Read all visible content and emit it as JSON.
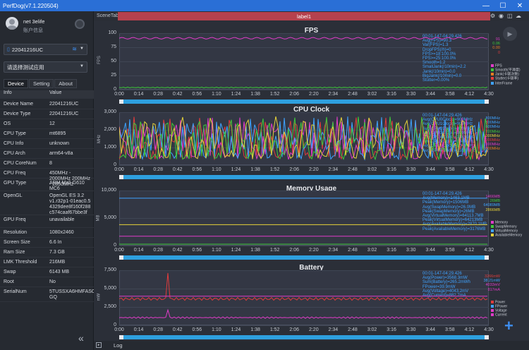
{
  "window": {
    "title": "PerfDog(v7.1.220504)"
  },
  "user": {
    "name": "net 3elife",
    "group": "账户信息"
  },
  "device_select": "22041216UC",
  "app_select": "请选择测试应用",
  "tabs": [
    "Device",
    "Setting",
    "About"
  ],
  "info": {
    "header": {
      "k": "Info",
      "v": "Value"
    },
    "rows": [
      {
        "k": "Device Name",
        "v": "22041216UC"
      },
      {
        "k": "Device Type",
        "v": "22041216UC"
      },
      {
        "k": "OS",
        "v": "12"
      },
      {
        "k": "CPU Type",
        "v": "mt6895"
      },
      {
        "k": "CPU Info",
        "v": "unknown"
      },
      {
        "k": "CPU Arch",
        "v": "arm64-v8a"
      },
      {
        "k": "CPU CoreNum",
        "v": "8"
      },
      {
        "k": "CPU Freq",
        "v": "450MHz - 2000MHz 200MHz - 2850MHz"
      },
      {
        "k": "GPU Type",
        "v": "ARM Mali-G610 MC6"
      },
      {
        "k": "OpenGL",
        "v": "OpenGL ES 3.2 v1.r32p1-01eac0.5 4329dee8f160f288 c574caaf67bbe3f"
      },
      {
        "k": "GPU Freq",
        "v": "unavailable"
      },
      {
        "k": "Resolution",
        "v": "1080x2460"
      },
      {
        "k": "Screen Size",
        "v": "6.6 In"
      },
      {
        "k": "Ram Size",
        "v": "7.3 GB"
      },
      {
        "k": "LMK Threshold",
        "v": "216MB"
      },
      {
        "k": "Swap",
        "v": "6143 MB"
      },
      {
        "k": "Root",
        "v": "No"
      },
      {
        "k": "SerialNum",
        "v": "5TUSSXA6HMFASO GQ"
      }
    ]
  },
  "scene": {
    "tab_label": "SceneTab",
    "label": "label1"
  },
  "xticks": [
    "0:00",
    "0:14",
    "0:28",
    "0:42",
    "0:56",
    "1:10",
    "1:24",
    "1:38",
    "1:52",
    "2:06",
    "2:20",
    "2:34",
    "2:48",
    "3:02",
    "3:16",
    "3:30",
    "3:44",
    "3:58",
    "4:12",
    "4:30"
  ],
  "panels": {
    "fps": {
      "title": "FPS",
      "ylabel": "FPS",
      "yticks": [
        "100",
        "75",
        "50",
        "25",
        "0"
      ],
      "stats": [
        "00:01-147-04:29.426",
        "Avg(FPS)=90.3",
        "Var(FPS)=1.3",
        "DropFPS(/h)=0",
        "FPS>=18:100.0%",
        "FPS>=25:100.0%",
        "Smooth=1.2",
        "SmallJank(/10min)=2.2",
        "Jank(/10min)=0.0",
        "BigJank(/10min)=0.0",
        "Stutter=0.00%"
      ],
      "vals": [
        {
          "t": "91",
          "c": "#e03cc8"
        },
        {
          "t": "0.06",
          "c": "#3ec93a"
        },
        {
          "t": "0.00",
          "c": "#e67e22"
        },
        {
          "t": "0",
          "c": "#e03c3c"
        }
      ],
      "legend": [
        {
          "t": "FPS",
          "c": "#e03cc8"
        },
        {
          "t": "Smooth(平滑度)",
          "c": "#3ec93a"
        },
        {
          "t": "Jank(卡顿次数)",
          "c": "#e67e22"
        },
        {
          "t": "Stutter(卡顿率)",
          "c": "#e03c3c"
        },
        {
          "t": "InterFrame",
          "c": "#3fa3ff"
        }
      ]
    },
    "cpu": {
      "title": "CPU Clock",
      "ylabel": "MHz",
      "yticks": [
        "3,000",
        "2,000",
        "1,000",
        "0"
      ],
      "stats": [
        "00:01-147-04:29.426",
        "Avg(CPU0Clock)=909MHz",
        "Avg(CPU1Clock)=909MHz",
        "Avg(CPU2Clock)=909MHz",
        "Avg(CPU3Clock)=909MHz",
        "Avg(CPU4Clock)=1349MHz",
        "Avg(CPU5Clock)=1349MHz",
        "Avg(CPU6Clock)=1349MHz",
        "Avg(CPU7Clock)=1553MHz"
      ],
      "vals": [
        {
          "t": "800MHz",
          "c": "#3fa3ff"
        },
        {
          "t": "800MHz",
          "c": "#3fa3ff"
        },
        {
          "t": "800MHz",
          "c": "#3fa3ff"
        },
        {
          "t": "800MHz",
          "c": "#3ec93a"
        },
        {
          "t": "1000MHz",
          "c": "#e6d23a"
        },
        {
          "t": "1000MHz",
          "c": "#e03c3c"
        },
        {
          "t": "1000MHz",
          "c": "#e03cc8"
        },
        {
          "t": "1000MHz",
          "c": "#e67e22"
        }
      ],
      "legend": []
    },
    "memory": {
      "title": "Memory Usage",
      "ylabel": "MB",
      "yticks": [
        "10,000",
        "5,000",
        "0"
      ],
      "stats": [
        "00:01-147-04:29.426",
        "Avg(Memory)=1463.1MB",
        "Peak(Memory)=1506MB",
        "Avg(SwapMemory)=26.0MB",
        "Peak(SwapMemory)=26MB",
        "Avg(VirtualMemory)=64113.7MB",
        "Peak(VirtualMemory)=64213MB",
        "Avg(AvailableMemory)=2870.1MB",
        "Peak(AvailableMemory)=3176MB"
      ],
      "vals": [
        {
          "t": "1466MB",
          "c": "#e03cc8"
        },
        {
          "t": "26MB",
          "c": "#3ec93a"
        },
        {
          "t": "64089MB",
          "c": "#3fa3ff"
        },
        {
          "t": "2866MB",
          "c": "#e6d23a"
        }
      ],
      "legend": [
        {
          "t": "Memory",
          "c": "#e03cc8"
        },
        {
          "t": "SwapMemory",
          "c": "#3ec93a"
        },
        {
          "t": "VirtualMemory",
          "c": "#3fa3ff"
        },
        {
          "t": "AvailableMemory",
          "c": "#e6d23a"
        }
      ]
    },
    "battery": {
      "title": "Battery",
      "ylabel": "mW",
      "yticks": [
        "7,500",
        "5,000",
        "2,500",
        "0"
      ],
      "stats": [
        "00:01-147-04:29.426",
        "Avg(Power)=3568.3mW",
        "Sum(Battery)=265.2mWh",
        "FPower=39.9mW",
        "Avg(Voltage)=4043.2mV",
        "Avg(Current)=882.7mA"
      ],
      "vals": [
        {
          "t": "3266mW",
          "c": "#e03c3c"
        },
        {
          "t": "38.21mW",
          "c": "#3fa3ff"
        },
        {
          "t": "4033mV",
          "c": "#e03cc8"
        },
        {
          "t": "817mA",
          "c": "#e03cc8"
        }
      ],
      "legend": [
        {
          "t": "Power",
          "c": "#e03c3c"
        },
        {
          "t": "FPower",
          "c": "#3fa3ff"
        },
        {
          "t": "Voltage",
          "c": "#e03cc8"
        },
        {
          "t": "Current",
          "c": "#e03cc8"
        }
      ]
    }
  },
  "log_label": "Log"
}
